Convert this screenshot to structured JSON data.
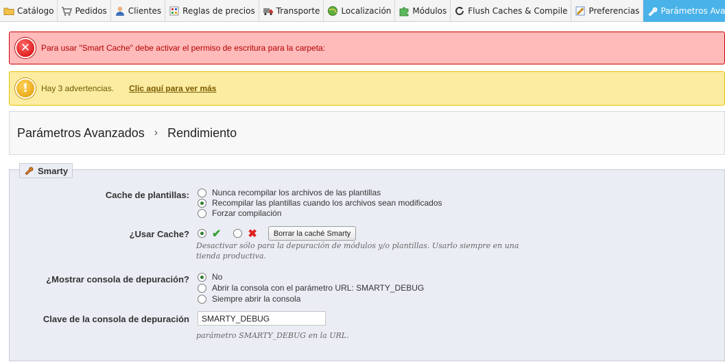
{
  "nav": {
    "tabs": [
      {
        "label": "Catálogo",
        "icon": "folder-icon"
      },
      {
        "label": "Pedidos",
        "icon": "cart-icon"
      },
      {
        "label": "Clientes",
        "icon": "user-icon"
      },
      {
        "label": "Reglas de precios",
        "icon": "price-rules-icon"
      },
      {
        "label": "Transporte",
        "icon": "truck-icon"
      },
      {
        "label": "Localización",
        "icon": "globe-icon"
      },
      {
        "label": "Módulos",
        "icon": "puzzle-icon"
      },
      {
        "label": "Flush Caches & Compile",
        "icon": "refresh-icon"
      },
      {
        "label": "Preferencias",
        "icon": "preferences-icon"
      },
      {
        "label": "Parámetros Avanzados",
        "icon": "wrench-icon"
      }
    ],
    "active_tab": "Parámetros Avanzados",
    "active_color": "#49b2e8"
  },
  "alerts": {
    "error": {
      "message": "Para usar \"Smart Cache\" debe activar el permiso de escritura para la carpeta:",
      "icon": "error-x-icon",
      "color": "#ffbaba"
    },
    "warning": {
      "message": "Hay 3 advertencias.",
      "link": "Clic aquí para ver más",
      "icon": "warning-exclamation-icon",
      "color": "#fbeca1"
    }
  },
  "breadcrumb": {
    "parent": "Parámetros Avanzados",
    "separator": "›",
    "current": "Rendimiento"
  },
  "smarty": {
    "legend": "Smarty",
    "legend_icon": "wrench-icon",
    "cache_templates": {
      "label": "Cache de plantillas:",
      "options": [
        "Nunca recompilar los archivos de las plantillas",
        "Recompilar las plantillas cuando los archivos sean modificados",
        "Forzar compilación"
      ],
      "selected_index": 1
    },
    "use_cache": {
      "label": "¿Usar Cache?",
      "selected": "yes",
      "clear_button": "Borrar la caché Smarty",
      "hint": "Desactivar sólo para la depuración de módulos y/o plantillas. Usarlo siempre en una tienda productiva."
    },
    "debug_console": {
      "label": "¿Mostrar consola de depuración?",
      "options": [
        "No",
        "Abrir la consola con el parámetro URL: SMARTY_DEBUG",
        "Siempre abrir la consola"
      ],
      "selected_index": 0
    },
    "debug_key": {
      "label": "Clave de la consola de depuración",
      "value": "SMARTY_DEBUG",
      "hint": "parámetro SMARTY_DEBUG en la URL."
    }
  }
}
